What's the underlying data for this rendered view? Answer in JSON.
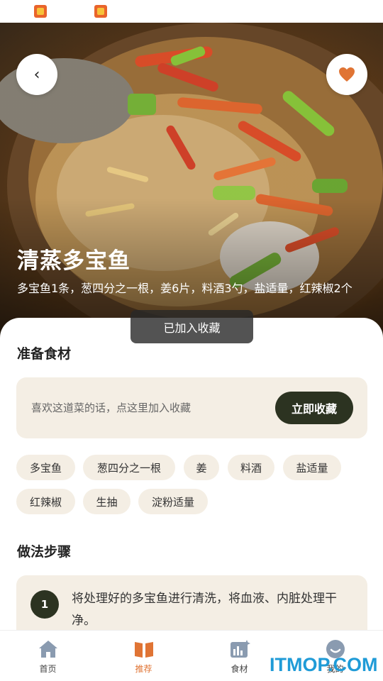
{
  "hero": {
    "title": "清蒸多宝鱼",
    "description": "多宝鱼1条，葱四分之一根，姜6片，料酒3勺，盐适量，红辣椒2个"
  },
  "toast": {
    "text": "已加入收藏"
  },
  "ingredients": {
    "section_title": "准备食材",
    "promo_text": "喜欢这道菜的话，点这里加入收藏",
    "promo_button": "立即收藏",
    "items": [
      "多宝鱼",
      "葱四分之一根",
      "姜",
      "料酒",
      "盐适量",
      "红辣椒",
      "生抽",
      "淀粉适量"
    ]
  },
  "steps": {
    "section_title": "做法步骤",
    "items": [
      {
        "number": "1",
        "text": "将处理好的多宝鱼进行清洗，将血液、内脏处理干净。"
      }
    ]
  },
  "tabbar": {
    "tabs": [
      {
        "label": "首页",
        "icon": "home-icon"
      },
      {
        "label": "推荐",
        "icon": "book-icon"
      },
      {
        "label": "食材",
        "icon": "chart-icon"
      },
      {
        "label": "我的",
        "icon": "smile-icon"
      }
    ],
    "active": 1
  },
  "watermark": "ITMOP.COM",
  "colors": {
    "accent": "#e07434",
    "dark_button": "#2c3321",
    "card_bg": "#f4eee4",
    "watermark": "#1f9bd7"
  }
}
